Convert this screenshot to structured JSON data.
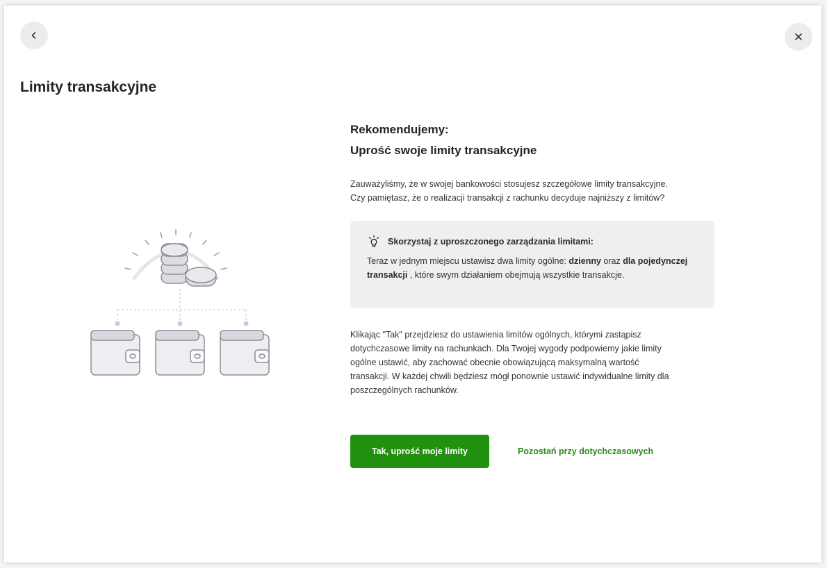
{
  "header": {
    "back_icon": "chevron-left-icon",
    "close_icon": "close-icon",
    "title": "Limity transakcyjne"
  },
  "illustration": {
    "icon": "coins-wallets-illustration"
  },
  "content": {
    "eyebrow": "Rekomendujemy:",
    "headline": "Uprość swoje limity transakcyjne",
    "intro": "Zauważyliśmy, że w swojej bankowości stosujesz szczegółowe limity transakcyjne.\nCzy pamiętasz, że o realizacji transakcji z rachunku decyduje najniższy z limitów?",
    "tip": {
      "icon": "lightbulb-icon",
      "title": "Skorzystaj z uproszczonego zarządzania limitami:",
      "text_1": "Teraz w jednym miejscu ustawisz dwa limity ogólne: ",
      "bold_1": "dzienny",
      "text_2": " oraz ",
      "bold_2": "dla pojedynczej transakcji",
      "text_3": " , które swym działaniem obejmują wszystkie transakcje."
    },
    "description": "Klikając \"Tak\" przejdziesz do ustawienia limitów ogólnych, którymi zastąpisz\ndotychczasowe limity na rachunkach. Dla Twojej wygody podpowiemy jakie limity\nogólne ustawić, aby zachować obecnie obowiązującą maksymalną wartość\ntransakcji. W każdej chwili będziesz mógł ponownie ustawić indywidualne limity dla\nposzczególnych rachunków."
  },
  "actions": {
    "primary_label": "Tak, uprość moje limity",
    "secondary_label": "Pozostań przy dotychczasowych"
  },
  "colors": {
    "primary": "#22900f",
    "link": "#2b8a1a",
    "tip_background": "#efeff0"
  }
}
